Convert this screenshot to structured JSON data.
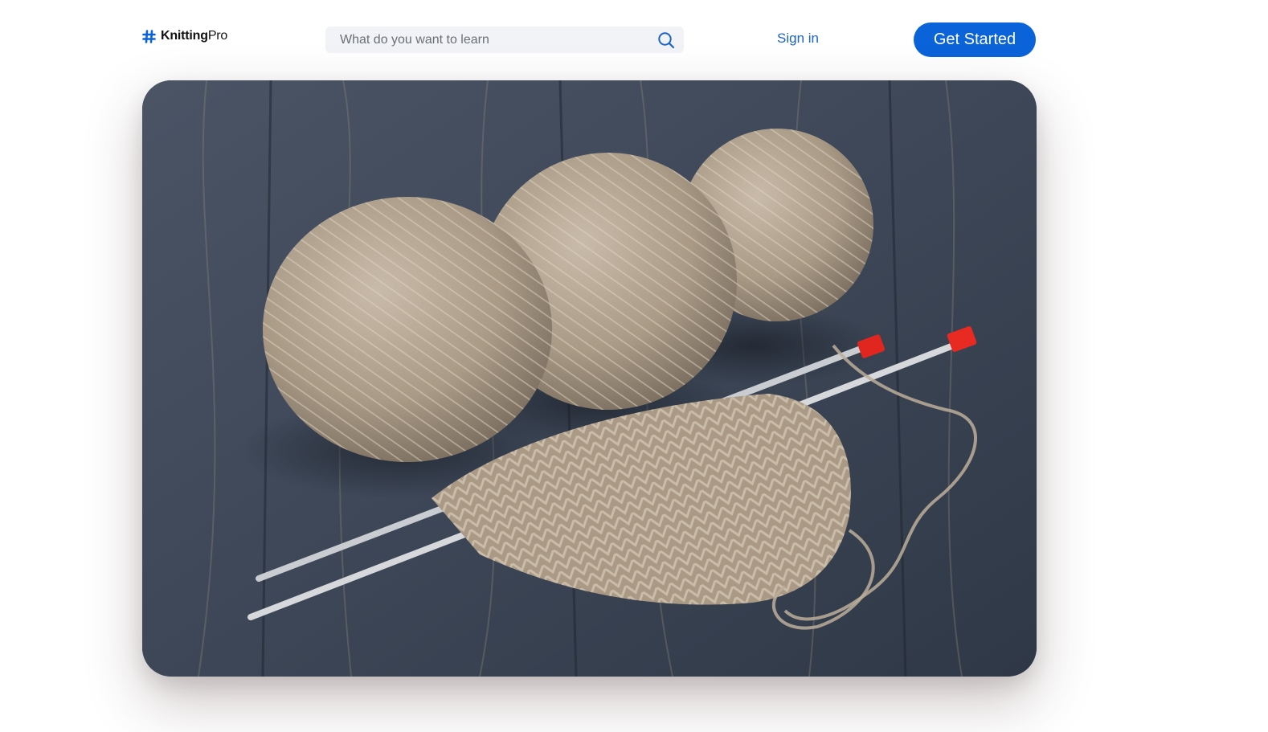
{
  "brand": {
    "name_bold": "Knitting",
    "name_light": "Pro",
    "icon": "hash-icon",
    "color": "#0b63da"
  },
  "search": {
    "placeholder": "What do you want to learn",
    "value": "",
    "icon": "search-icon"
  },
  "nav": {
    "sign_in_label": "Sign in",
    "cta_label": "Get Started"
  },
  "hero": {
    "image_subject": "balls of beige wool yarn with knitting needles and a knitted swatch on a dark wooden table"
  },
  "colors": {
    "accent": "#0b63da",
    "link": "#1d64c8",
    "search_bg": "#f1f3f6",
    "background": "#ffffff"
  }
}
